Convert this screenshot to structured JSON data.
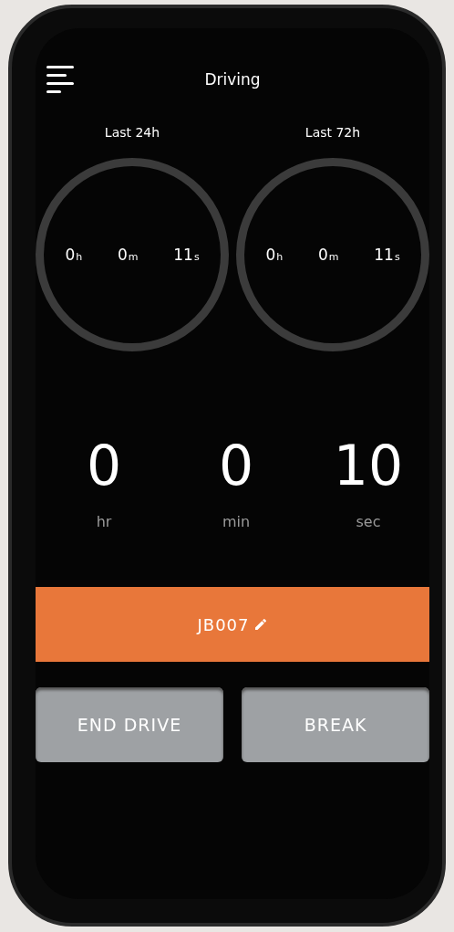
{
  "header": {
    "title": "Driving"
  },
  "rings": [
    {
      "label": "Last 24h",
      "values": [
        {
          "num": "0",
          "unit": "h"
        },
        {
          "num": "0",
          "unit": "m"
        },
        {
          "num": "11",
          "unit": "s"
        }
      ]
    },
    {
      "label": "Last 72h",
      "values": [
        {
          "num": "0",
          "unit": "h"
        },
        {
          "num": "0",
          "unit": "m"
        },
        {
          "num": "11",
          "unit": "s"
        }
      ]
    }
  ],
  "timer": [
    {
      "value": "0",
      "unit": "hr"
    },
    {
      "value": "0",
      "unit": "min"
    },
    {
      "value": "10",
      "unit": "sec"
    }
  ],
  "vehicle": {
    "label": "JB007"
  },
  "buttons": [
    "END DRIVE",
    "BREAK"
  ]
}
